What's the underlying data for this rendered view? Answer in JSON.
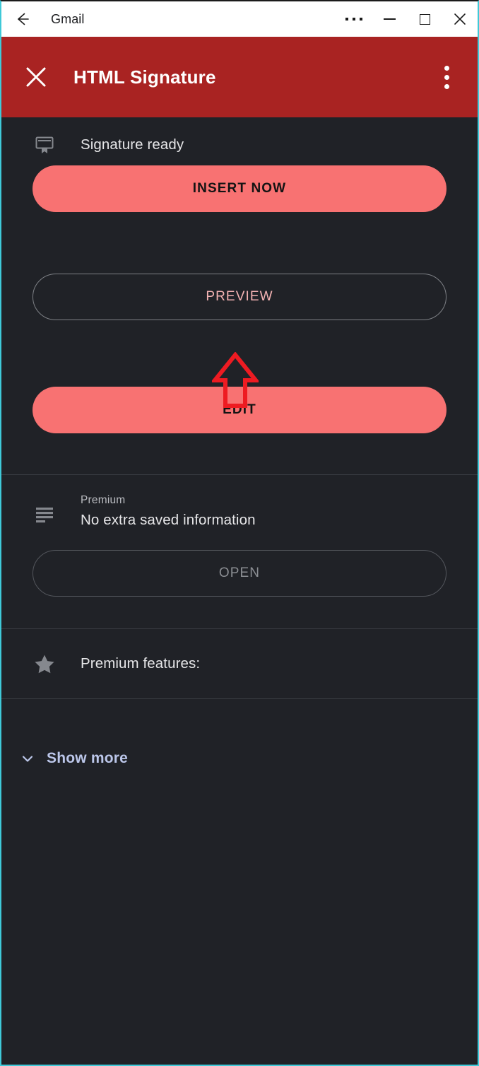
{
  "window": {
    "title": "Gmail",
    "back_icon": "arrow-left-icon",
    "more_icon": "ellipsis-horizontal-icon",
    "minimize_icon": "minimize-icon",
    "maximize_icon": "maximize-icon",
    "close_icon": "close-icon",
    "frame_accent_color": "#3fc9d8"
  },
  "app_header": {
    "title": "HTML Signature",
    "close_icon": "close-icon",
    "overflow_icon": "kebab-menu-icon",
    "background_color": "#a92322",
    "text_color": "#ffffff"
  },
  "main": {
    "background_color": "#202227",
    "status": {
      "icon": "certificate-icon",
      "text": "Signature ready"
    },
    "insert_button": {
      "label": "INSERT NOW",
      "background_color": "#f87272",
      "text_color": "#131313"
    },
    "preview_button": {
      "label": "PREVIEW",
      "text_color": "#f4b3b3",
      "border_color": "#7e8186"
    },
    "edit_button": {
      "label": "EDIT",
      "background_color": "#f87272",
      "text_color": "#131313"
    }
  },
  "premium_section": {
    "icon": "list-lines-icon",
    "label": "Premium",
    "value": "No extra saved information",
    "open_button": {
      "label": "OPEN",
      "text_color": "#8b8e93",
      "border_color": "#53565c"
    }
  },
  "features_section": {
    "icon": "star-icon",
    "text": "Premium features:"
  },
  "show_more": {
    "icon": "chevron-down-icon",
    "label": "Show more",
    "text_color": "#bcc7ea"
  },
  "annotation": {
    "type": "arrow-up-annotation",
    "color": "#ee1b22",
    "points_to": "INSERT NOW"
  }
}
